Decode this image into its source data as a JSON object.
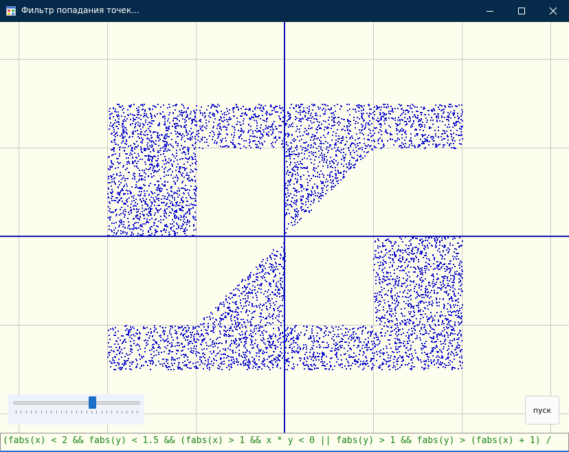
{
  "window": {
    "title": "Фильтр попадания точек...",
    "app_icon": "window-app-icon",
    "controls": [
      "minimize-icon",
      "maximize-icon",
      "close-icon"
    ]
  },
  "plot": {
    "background": "#fefeee",
    "grid_color": "#c8c8c8",
    "axis_color": "#0a14b4",
    "point_color": "#1010d0",
    "units_per_cell": 1,
    "visible_x_range": [
      -3.2,
      3.2
    ],
    "visible_y_range": [
      -2.2,
      2.4
    ],
    "sample_x_range": [
      -2,
      2
    ],
    "sample_y_range": [
      -1.5,
      1.5
    ],
    "region_rule": "|x|<2 and |y|<1.5 and ((|x|>1 and x*y<0) or (|y|>1 and |y|>(|x|+1)/... ) ...) — first visible part of the formula shown in the field below"
  },
  "slider": {
    "value_fraction": 0.63,
    "tick_count": 24
  },
  "controls": {
    "start_label": "пуск"
  },
  "formula": {
    "text": "(fabs(x) < 2 && fabs(y) < 1.5 && (fabs(x) > 1 && x * y < 0 || fabs(y) > 1 && fabs(y) > (fabs(x) + 1) /"
  }
}
